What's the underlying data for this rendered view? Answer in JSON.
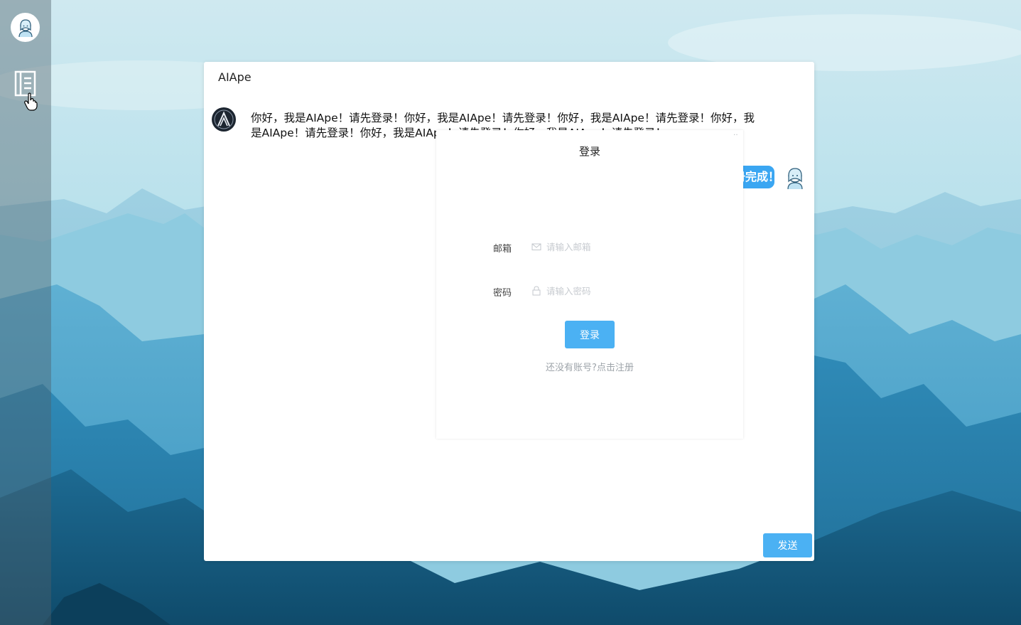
{
  "sidebar": {
    "avatar_icon": "user-avatar-icon",
    "menu_icon": "list-icon"
  },
  "chat": {
    "title": "AIApe",
    "bot_message": "你好，我是AIApe！请先登录！你好，我是AIApe！请先登录！你好，我是AIApe！请先登录！你好，我是AIApe！请先登录！你好，我是AIApe！请先登录！你好，我是AIApe！请先登录！",
    "user_message": "注册完成！",
    "send_label": "发送"
  },
  "login": {
    "title": "登录",
    "email_label": "邮箱",
    "email_placeholder": "请输入邮箱",
    "password_label": "密码",
    "password_placeholder": "请输入密码",
    "submit_label": "登录",
    "register_link": "还没有账号?点击注册"
  },
  "colors": {
    "accent": "#4bb1f3",
    "sidebar": "#4e606a"
  }
}
